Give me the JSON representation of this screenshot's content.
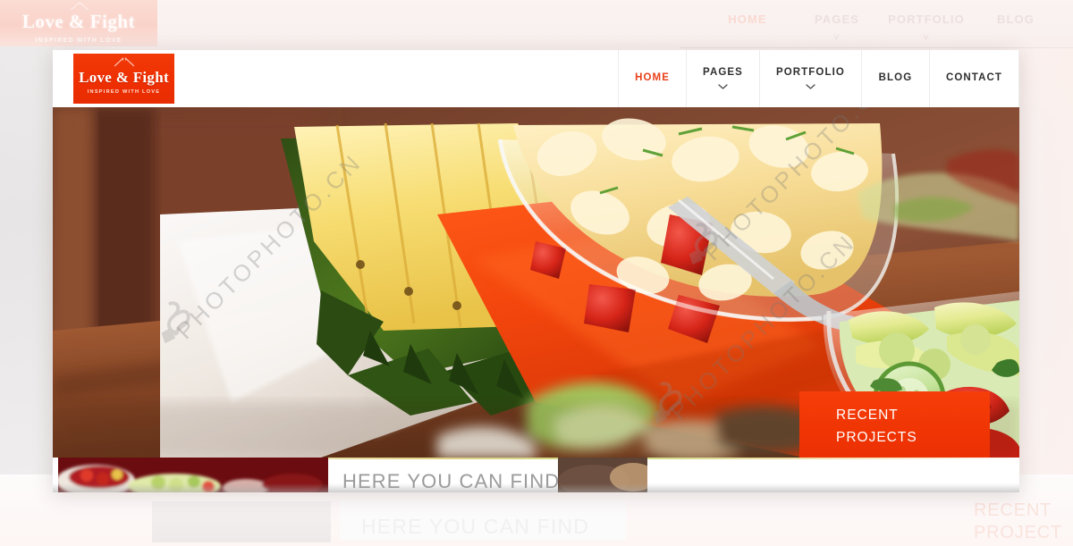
{
  "site": {
    "brand": {
      "name": "Love & Fight",
      "tagline": "INSPIRED WITH LOVE",
      "logo_icon": "crossed-utensils-icon",
      "background_color": "#f03305",
      "text_color": "#ffffff"
    },
    "accent_color": "#e8401a",
    "badge_color": "#f03605"
  },
  "nav": {
    "items": [
      {
        "label": "HOME",
        "active": true,
        "has_dropdown": false
      },
      {
        "label": "PAGES",
        "active": false,
        "has_dropdown": true
      },
      {
        "label": "PORTFOLIO",
        "active": false,
        "has_dropdown": true
      },
      {
        "label": "BLOG",
        "active": false,
        "has_dropdown": false
      },
      {
        "label": "CONTACT",
        "active": false,
        "has_dropdown": false
      }
    ]
  },
  "hero": {
    "alt": "Table spread with sliced pineapple on a white napkin, a glass bowl of pasta salad on an orange napkin with a fork, and a glass bowl of fresh cucumber, tomato and pepper salad on a wooden table",
    "badge": {
      "line1": "RECENT",
      "line2": "PROJECTS"
    },
    "watermark": {
      "text": "PHOTOPHOTO.CN",
      "short": "PHOTO.CN"
    }
  },
  "content": {
    "heading": "HERE YOU CAN FIND",
    "thumbnail_alt": "Bowl of red berries beside a plate of chopped green salad on a dark red background"
  },
  "ghost": {
    "nav": [
      {
        "label": "HOME",
        "active": true,
        "has_dropdown": false
      },
      {
        "label": "PAGES",
        "active": false,
        "has_dropdown": true
      },
      {
        "label": "PORTFOLIO",
        "active": false,
        "has_dropdown": true
      },
      {
        "label": "BLOG",
        "active": false,
        "has_dropdown": false
      }
    ],
    "brand_name": "Love & Fight",
    "brand_tagline": "INSPIRED WITH LOVE",
    "heading": "HERE YOU CAN FIND",
    "badge_line1": "RECENT",
    "badge_line2": "PROJECT"
  }
}
